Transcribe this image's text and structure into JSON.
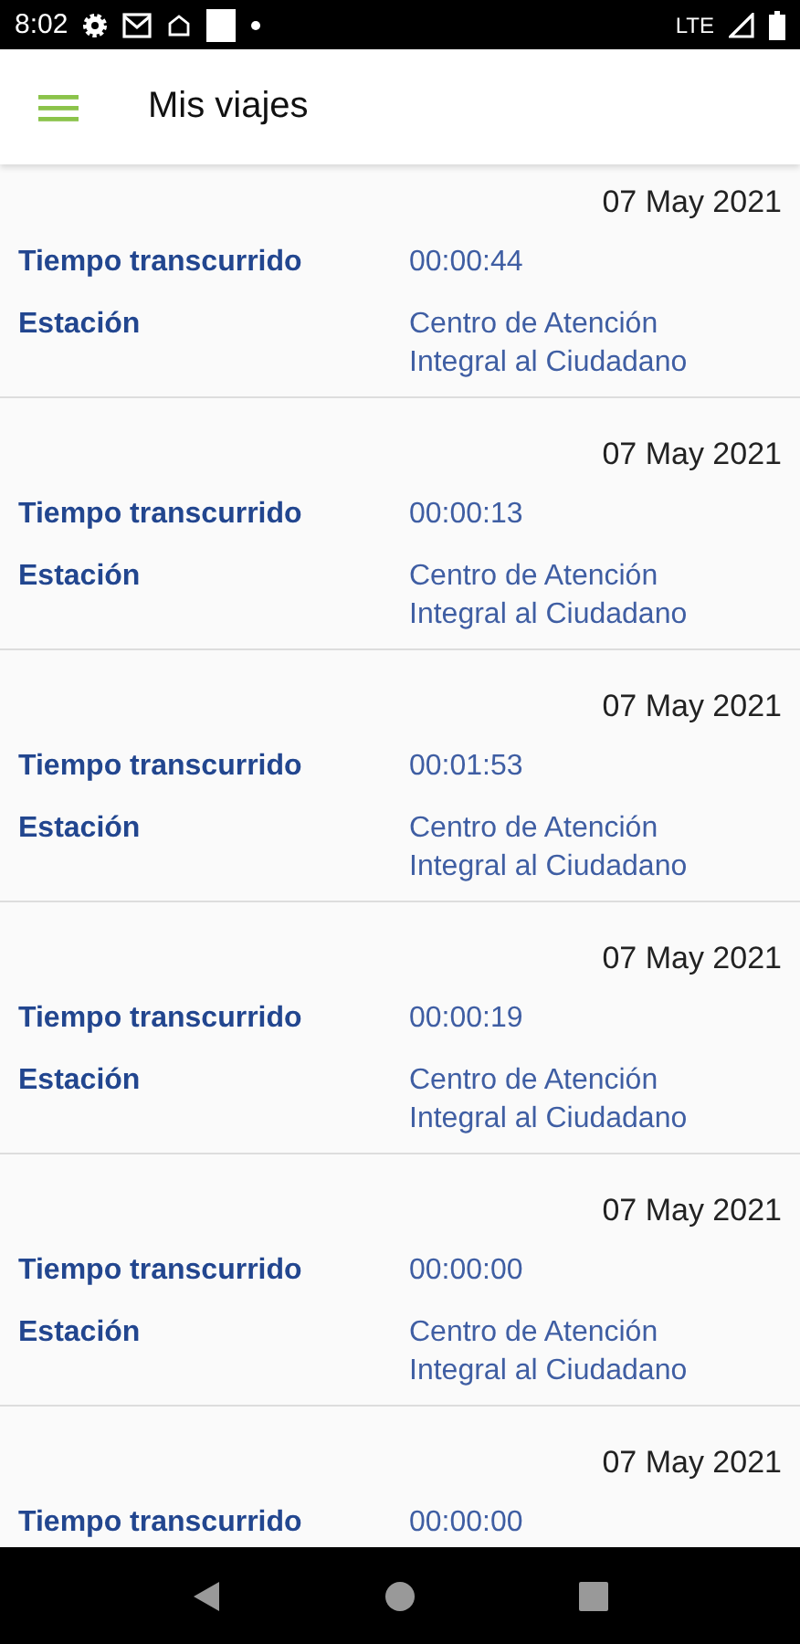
{
  "status_bar": {
    "time": "8:02",
    "network": "LTE"
  },
  "app_bar": {
    "title": "Mis viajes"
  },
  "trips": [
    {
      "date": "07 May 2021",
      "rows": [
        {
          "label": "Tiempo transcurrido",
          "value": "00:00:44"
        },
        {
          "label": "Estación",
          "value": "Centro de Atención Integral al Ciudadano"
        }
      ]
    },
    {
      "date": "07 May 2021",
      "rows": [
        {
          "label": "Tiempo transcurrido",
          "value": "00:00:13"
        },
        {
          "label": "Estación",
          "value": "Centro de Atención Integral al Ciudadano"
        }
      ]
    },
    {
      "date": "07 May 2021",
      "rows": [
        {
          "label": "Tiempo transcurrido",
          "value": "00:01:53"
        },
        {
          "label": "Estación",
          "value": "Centro de Atención Integral al Ciudadano"
        }
      ]
    },
    {
      "date": "07 May 2021",
      "rows": [
        {
          "label": "Tiempo transcurrido",
          "value": "00:00:19"
        },
        {
          "label": "Estación",
          "value": "Centro de Atención Integral al Ciudadano"
        }
      ]
    },
    {
      "date": "07 May 2021",
      "rows": [
        {
          "label": "Tiempo transcurrido",
          "value": "00:00:00"
        },
        {
          "label": "Estación",
          "value": "Centro de Atención Integral al Ciudadano"
        }
      ]
    },
    {
      "date": "07 May 2021",
      "rows": [
        {
          "label": "Tiempo transcurrido",
          "value": "00:00:00"
        }
      ]
    }
  ]
}
